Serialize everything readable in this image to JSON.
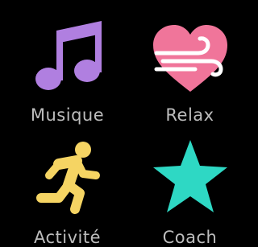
{
  "apps": [
    {
      "label": "Musique",
      "icon": "music-note-icon",
      "color": "#b07fe0"
    },
    {
      "label": "Relax",
      "icon": "heart-breathe-icon",
      "color": "#f0759a"
    },
    {
      "label": "Activité",
      "icon": "running-person-icon",
      "color": "#f5d463"
    },
    {
      "label": "Coach",
      "icon": "star-icon",
      "color": "#2ed8c4"
    }
  ]
}
